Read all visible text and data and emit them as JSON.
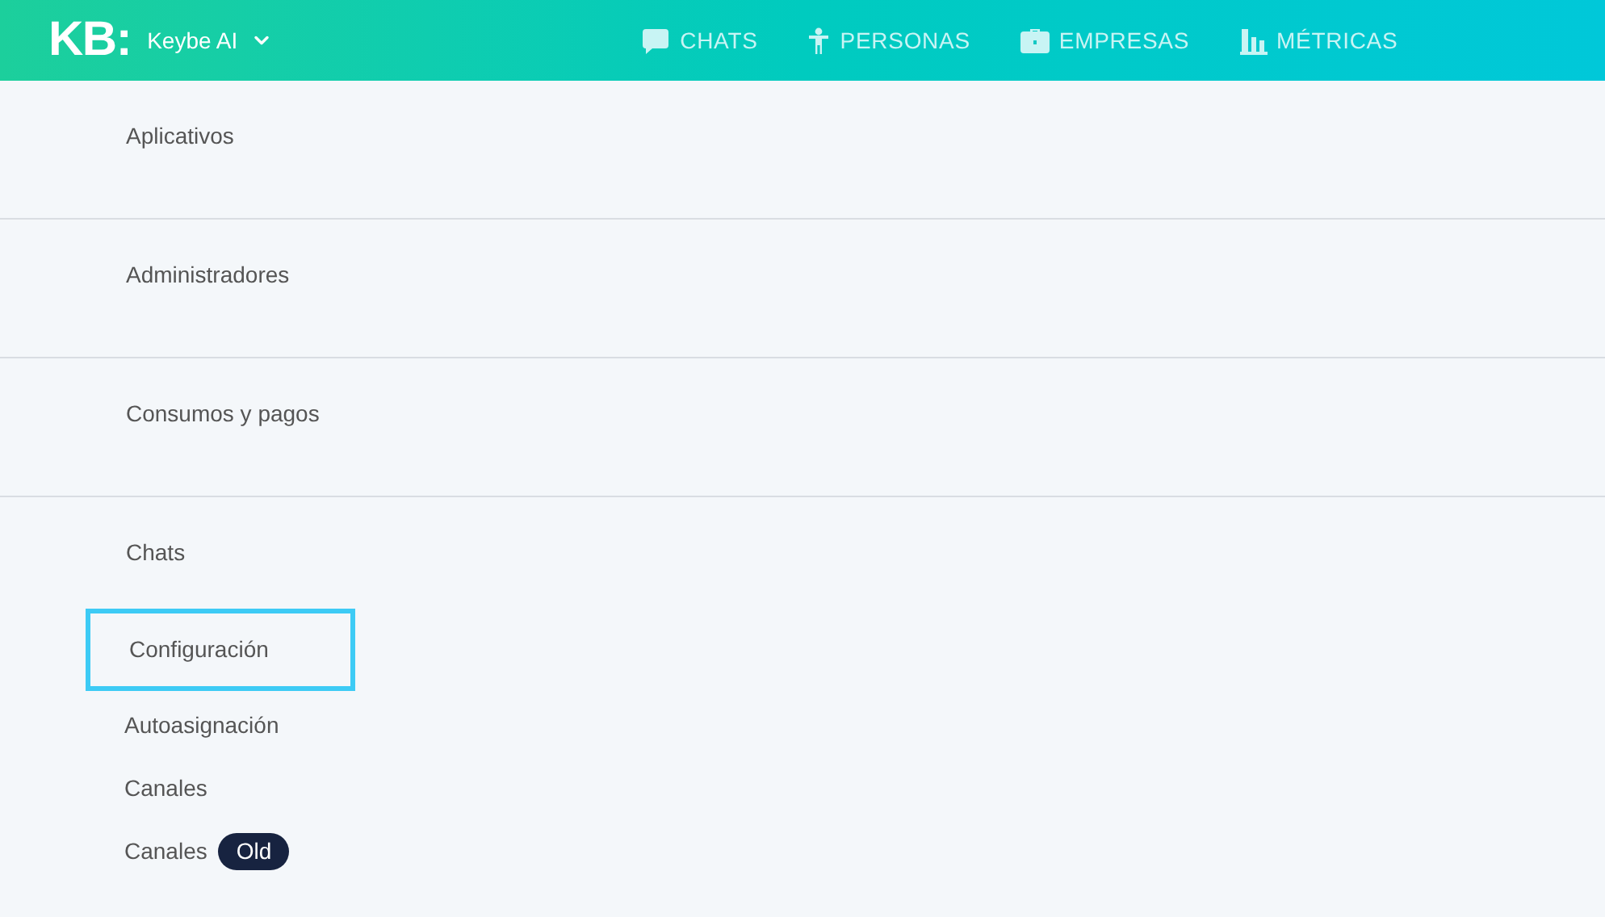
{
  "header": {
    "logo": "KB:",
    "workspace": "Keybe AI",
    "nav": [
      {
        "label": "CHATS"
      },
      {
        "label": "PERSONAS"
      },
      {
        "label": "EMPRESAS"
      },
      {
        "label": "MÉTRICAS"
      }
    ]
  },
  "sections": [
    {
      "title": "Aplicativos"
    },
    {
      "title": "Administradores"
    },
    {
      "title": "Consumos y pagos"
    },
    {
      "title": "Chats",
      "items": [
        {
          "label": "Configuración",
          "selected": true
        },
        {
          "label": "Autoasignación",
          "selected": false
        },
        {
          "label": "Canales",
          "selected": false
        },
        {
          "label": "Canales",
          "badge": "Old",
          "selected": false
        }
      ]
    }
  ]
}
